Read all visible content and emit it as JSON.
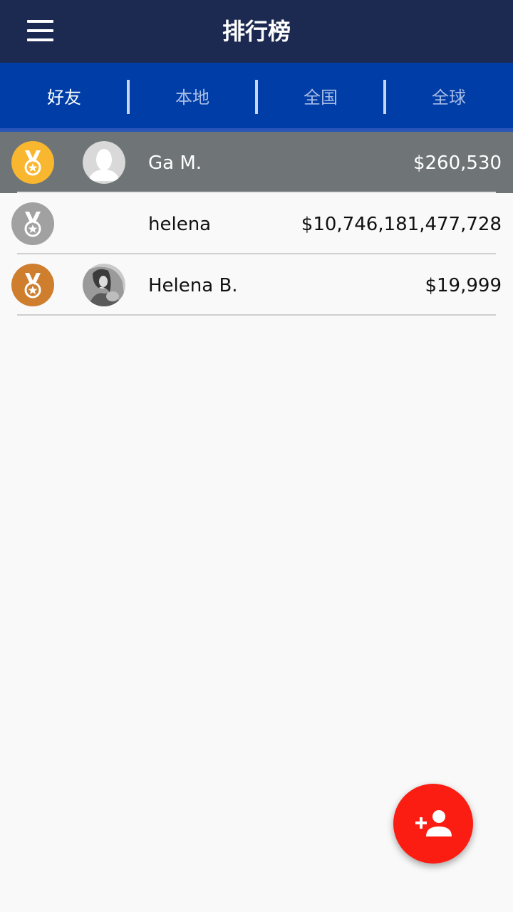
{
  "header": {
    "title": "排行榜",
    "menu_icon": "hamburger-menu-icon"
  },
  "tabs": [
    {
      "label": "好友",
      "active": true
    },
    {
      "label": "本地",
      "active": false
    },
    {
      "label": "全国",
      "active": false
    },
    {
      "label": "全球",
      "active": false
    }
  ],
  "leaderboard": [
    {
      "rank": 1,
      "medal": "gold-medal-icon",
      "avatar": "default-avatar",
      "name": "Ga M.",
      "amount": "$260,530",
      "highlighted": true
    },
    {
      "rank": 2,
      "medal": "silver-medal-icon",
      "avatar": "",
      "name": "helena",
      "amount": "$10,746,181,477,728",
      "highlighted": false
    },
    {
      "rank": 3,
      "medal": "bronze-medal-icon",
      "avatar": "photo-avatar",
      "name": "Helena B.",
      "amount": "$19,999",
      "highlighted": false
    }
  ],
  "fab": {
    "icon": "add-person-icon"
  },
  "colors": {
    "topbar": "#1c2a52",
    "tabbar": "#003da6",
    "highlight_row": "#6f7577",
    "gold": "#f9b62f",
    "silver": "#a1a1a1",
    "bronze": "#cf7e2e",
    "fab": "#fb1d12"
  }
}
